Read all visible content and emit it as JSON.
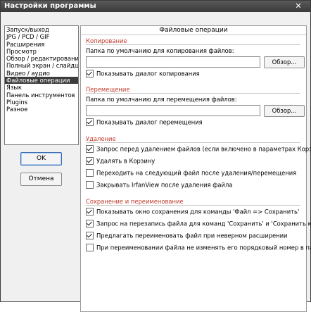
{
  "window": {
    "title": "Настройки программы",
    "close_glyph": "✕"
  },
  "nav": {
    "items": [
      {
        "label": "Запуск/выход",
        "selected": false
      },
      {
        "label": "JPG / PCD / GIF",
        "selected": false
      },
      {
        "label": "Расширения",
        "selected": false
      },
      {
        "label": "Просмотр",
        "selected": false
      },
      {
        "label": "Обзор / редактирование",
        "selected": false
      },
      {
        "label": "Полный экран / слайдшоу",
        "selected": false
      },
      {
        "label": "Видео / аудио",
        "selected": false
      },
      {
        "label": "Файловые операции",
        "selected": true
      },
      {
        "label": "Язык",
        "selected": false
      },
      {
        "label": "Панель инструментов",
        "selected": false
      },
      {
        "label": "Plugins",
        "selected": false
      },
      {
        "label": "Разное",
        "selected": false
      }
    ]
  },
  "buttons": {
    "ok": "OK",
    "cancel": "Отмена"
  },
  "panel": {
    "header": "Файловые операции",
    "copy": {
      "title": "Копирование",
      "label": "Папка по умолчанию для копирования файлов:",
      "value": "",
      "browse": "Обзор...",
      "show_dialog": {
        "label": "Показывать диалог копирования",
        "checked": true
      }
    },
    "move": {
      "title": "Перемещение",
      "label": "Папка по умолчанию для перемещения файлов:",
      "value": "",
      "browse": "Обзор...",
      "show_dialog": {
        "label": "Показывать диалог перемещения",
        "checked": true
      }
    },
    "delete": {
      "title": "Удаление",
      "options": [
        {
          "label": "Запрос перед удалением файлов (если включено в параметрах Корзины)",
          "checked": true
        },
        {
          "label": "Удалять в Корзину",
          "checked": true
        },
        {
          "label": "Переходить на следующий файл после удаления/перемещения",
          "checked": false
        },
        {
          "label": "Закрывать IrfanView после удаления файла",
          "checked": false
        }
      ]
    },
    "save": {
      "title": "Сохранение и переименование",
      "options": [
        {
          "label": "Показывать окно сохранения для команды 'Файл => Сохранить'",
          "checked": true
        },
        {
          "label": "Запрос на перезапись файла для команд 'Сохранить' и 'Сохранить как'",
          "checked": true
        },
        {
          "label": "Предлагать переименовать файл при неверном расширении",
          "checked": true
        },
        {
          "label": "При переименовании файла не изменять его порядковый номер в папке",
          "checked": false
        }
      ]
    }
  }
}
